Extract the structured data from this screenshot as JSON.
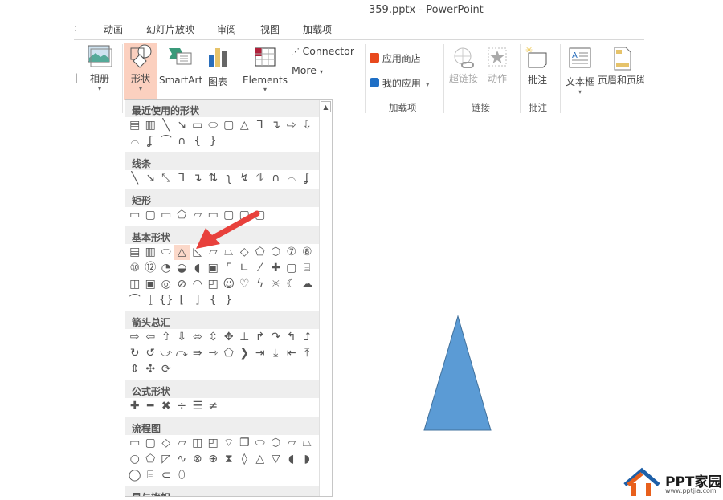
{
  "window": {
    "title": "359.pptx - PowerPoint"
  },
  "tabs": [
    "动画",
    "幻灯片放映",
    "审阅",
    "视图",
    "加载项"
  ],
  "ribbon": {
    "album": "相册",
    "shapes": "形状",
    "smartart": "SmartArt",
    "chart": "图表",
    "elements": "Elements",
    "connector": "Connector",
    "more": "More",
    "app_store": "应用商店",
    "my_apps": "我的应用",
    "hyperlink": "超链接",
    "action": "动作",
    "comment": "批注",
    "textbox": "文本框",
    "header_footer": "页眉和页脚",
    "groups": {
      "addins": "加载项",
      "links": "链接",
      "comments": "批注"
    },
    "active_color": "#fbd0bf"
  },
  "shapes_gallery": {
    "sections": [
      {
        "title": "最近使用的形状",
        "rows": [
          [
            "textbox",
            "vtextbox",
            "line",
            "arrow-line",
            "rect",
            "oval",
            "rounded-rect",
            "triangle",
            "elbow",
            "elbow-arrow",
            "right-arrow",
            "down-arrow"
          ],
          [
            "freeform",
            "scribble",
            "arc",
            "curve",
            "brace-left",
            "brace-right"
          ]
        ]
      },
      {
        "title": "线条",
        "rows": [
          [
            "line",
            "arrow-line",
            "double-arrow-line",
            "elbow",
            "elbow-arrow",
            "elbow-double-arrow",
            "curve-conn",
            "curve-arrow",
            "curve-double-arrow",
            "curve",
            "freeform",
            "scribble"
          ]
        ]
      },
      {
        "title": "矩形",
        "rows": [
          [
            "rect",
            "rounded-rect",
            "snip-rect",
            "snip2-rect",
            "snip-diag-rect",
            "snip-round-rect",
            "round1-rect",
            "round2-rect",
            "round-diag-rect"
          ]
        ]
      },
      {
        "title": "基本形状",
        "rows": [
          [
            "textbox",
            "vtextbox",
            "oval",
            "triangle",
            "right-triangle",
            "parallelogram",
            "trapezoid",
            "diamond",
            "pentagon",
            "hexagon",
            "heptagon",
            "octagon"
          ],
          [
            "decagon",
            "dodecagon",
            "pie",
            "chord",
            "teardrop",
            "frame",
            "half-frame",
            "l-shape",
            "diag-stripe",
            "cross",
            "plaque",
            "can"
          ],
          [
            "cube",
            "bevel",
            "donut",
            "no-symbol",
            "block-arc",
            "folded-corner",
            "smiley",
            "heart",
            "lightning",
            "sun",
            "moon",
            "cloud"
          ],
          [
            "arc",
            "double-bracket",
            "double-brace",
            "bracket-left",
            "bracket-right",
            "brace-left",
            "brace-right"
          ]
        ]
      },
      {
        "title": "箭头总汇",
        "rows": [
          [
            "right-arrow",
            "left-arrow",
            "up-arrow",
            "down-arrow",
            "left-right-arrow",
            "up-down-arrow",
            "quad-arrow",
            "left-right-up-arrow",
            "bent-arrow",
            "u-turn-arrow",
            "left-up-arrow",
            "bent-up-arrow"
          ],
          [
            "curved-right",
            "curved-left",
            "curved-up",
            "curved-down",
            "striped-right",
            "notched-right",
            "pentagon-arrow",
            "chevron",
            "right-callout",
            "down-callout",
            "left-callout",
            "up-callout"
          ],
          [
            "up-down-callout",
            "quad-callout",
            "circular-arrow"
          ]
        ]
      },
      {
        "title": "公式形状",
        "rows": [
          [
            "plus",
            "minus",
            "multiply",
            "divide",
            "equal",
            "not-equal"
          ]
        ]
      },
      {
        "title": "流程图",
        "rows": [
          [
            "process",
            "alt-process",
            "decision",
            "data",
            "predefined",
            "internal-storage",
            "document",
            "multidocument",
            "terminator",
            "preparation",
            "manual-input",
            "manual-operation"
          ],
          [
            "connector",
            "offpage",
            "card",
            "punched-tape",
            "summing",
            "or",
            "collate",
            "sort",
            "extract",
            "merge",
            "stored-data",
            "delay"
          ],
          [
            "sequential",
            "magnetic-disk",
            "direct-access",
            "display"
          ]
        ]
      },
      {
        "title": "星与旗帜",
        "rows": []
      }
    ],
    "selected": "triangle"
  },
  "slide": {
    "shape": "isosceles-triangle",
    "fill": "#5b9bd5",
    "stroke": "#41719c"
  },
  "annotation": {
    "color": "#e8413c"
  },
  "watermark": {
    "brand": "PPT家园",
    "url": "www.pptjia.com"
  }
}
